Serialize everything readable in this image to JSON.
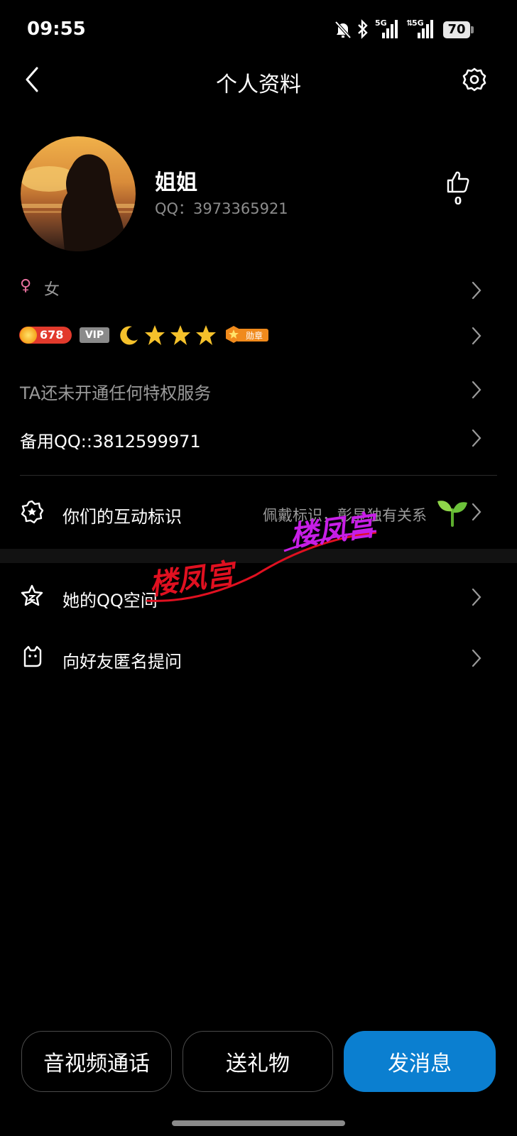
{
  "status_bar": {
    "time": "09:55",
    "net1": "5G",
    "net2": "5G",
    "battery": "70"
  },
  "header": {
    "title": "个人资料"
  },
  "profile": {
    "name": "姐姐",
    "qq_line": "QQ：3973365921",
    "like_count": "0"
  },
  "gender": {
    "symbol": "♀",
    "label": "女"
  },
  "level": {
    "coin": "678",
    "vip": "VIP",
    "medal": "勋章"
  },
  "privilege_text": "TA还未开通任何特权服务",
  "backup_qq": "备用QQ::3812599971",
  "interaction": {
    "label": "你们的互动标识",
    "hint": "佩戴标识，彰显独有关系"
  },
  "menu": [
    {
      "label": "她的QQ空间"
    },
    {
      "label": "向好友匿名提问"
    }
  ],
  "watermark": {
    "text1": "楼凤宫",
    "text2": "楼凤宫"
  },
  "bottom_buttons": {
    "call": "音视频通话",
    "gift": "送礼物",
    "message": "发消息"
  },
  "colors": {
    "primary": "#0b7fd0",
    "gender_pink": "#e8719f",
    "coin_red": "#e23a2c",
    "star_gold": "#f5c12b",
    "watermark_pink": "#c71ee6",
    "watermark_red": "#e01020"
  }
}
